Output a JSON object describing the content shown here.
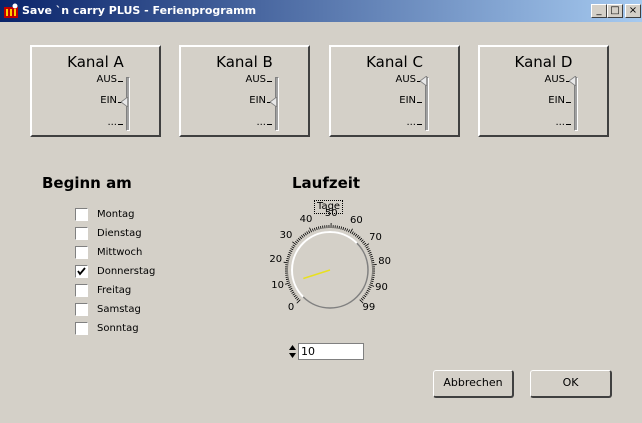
{
  "window": {
    "title": "Save `n carry PLUS - Ferienprogramm"
  },
  "titlebar_buttons": {
    "minimize": "_",
    "maximize": "□",
    "close": "×"
  },
  "channels": [
    {
      "name": "Kanal A",
      "labels": [
        "AUS",
        "EIN",
        "..."
      ],
      "state": "EIN"
    },
    {
      "name": "Kanal B",
      "labels": [
        "AUS",
        "EIN",
        "..."
      ],
      "state": "EIN"
    },
    {
      "name": "Kanal C",
      "labels": [
        "AUS",
        "EIN",
        "..."
      ],
      "state": "AUS"
    },
    {
      "name": "Kanal D",
      "labels": [
        "AUS",
        "EIN",
        "..."
      ],
      "state": "AUS"
    }
  ],
  "begin": {
    "title": "Beginn am",
    "days": [
      {
        "label": "Montag",
        "checked": false
      },
      {
        "label": "Dienstag",
        "checked": false
      },
      {
        "label": "Mittwoch",
        "checked": false
      },
      {
        "label": "Donnerstag",
        "checked": true
      },
      {
        "label": "Freitag",
        "checked": false
      },
      {
        "label": "Samstag",
        "checked": false
      },
      {
        "label": "Sonntag",
        "checked": false
      }
    ]
  },
  "runtime": {
    "title": "Laufzeit",
    "unit": "Tage",
    "scale_labels": [
      "0",
      "10",
      "20",
      "30",
      "40",
      "50",
      "60",
      "70",
      "80",
      "90",
      "99"
    ],
    "value": "10",
    "colors": {
      "needle": "#e8e020"
    }
  },
  "buttons": {
    "cancel": "Abbrechen",
    "ok": "OK"
  }
}
